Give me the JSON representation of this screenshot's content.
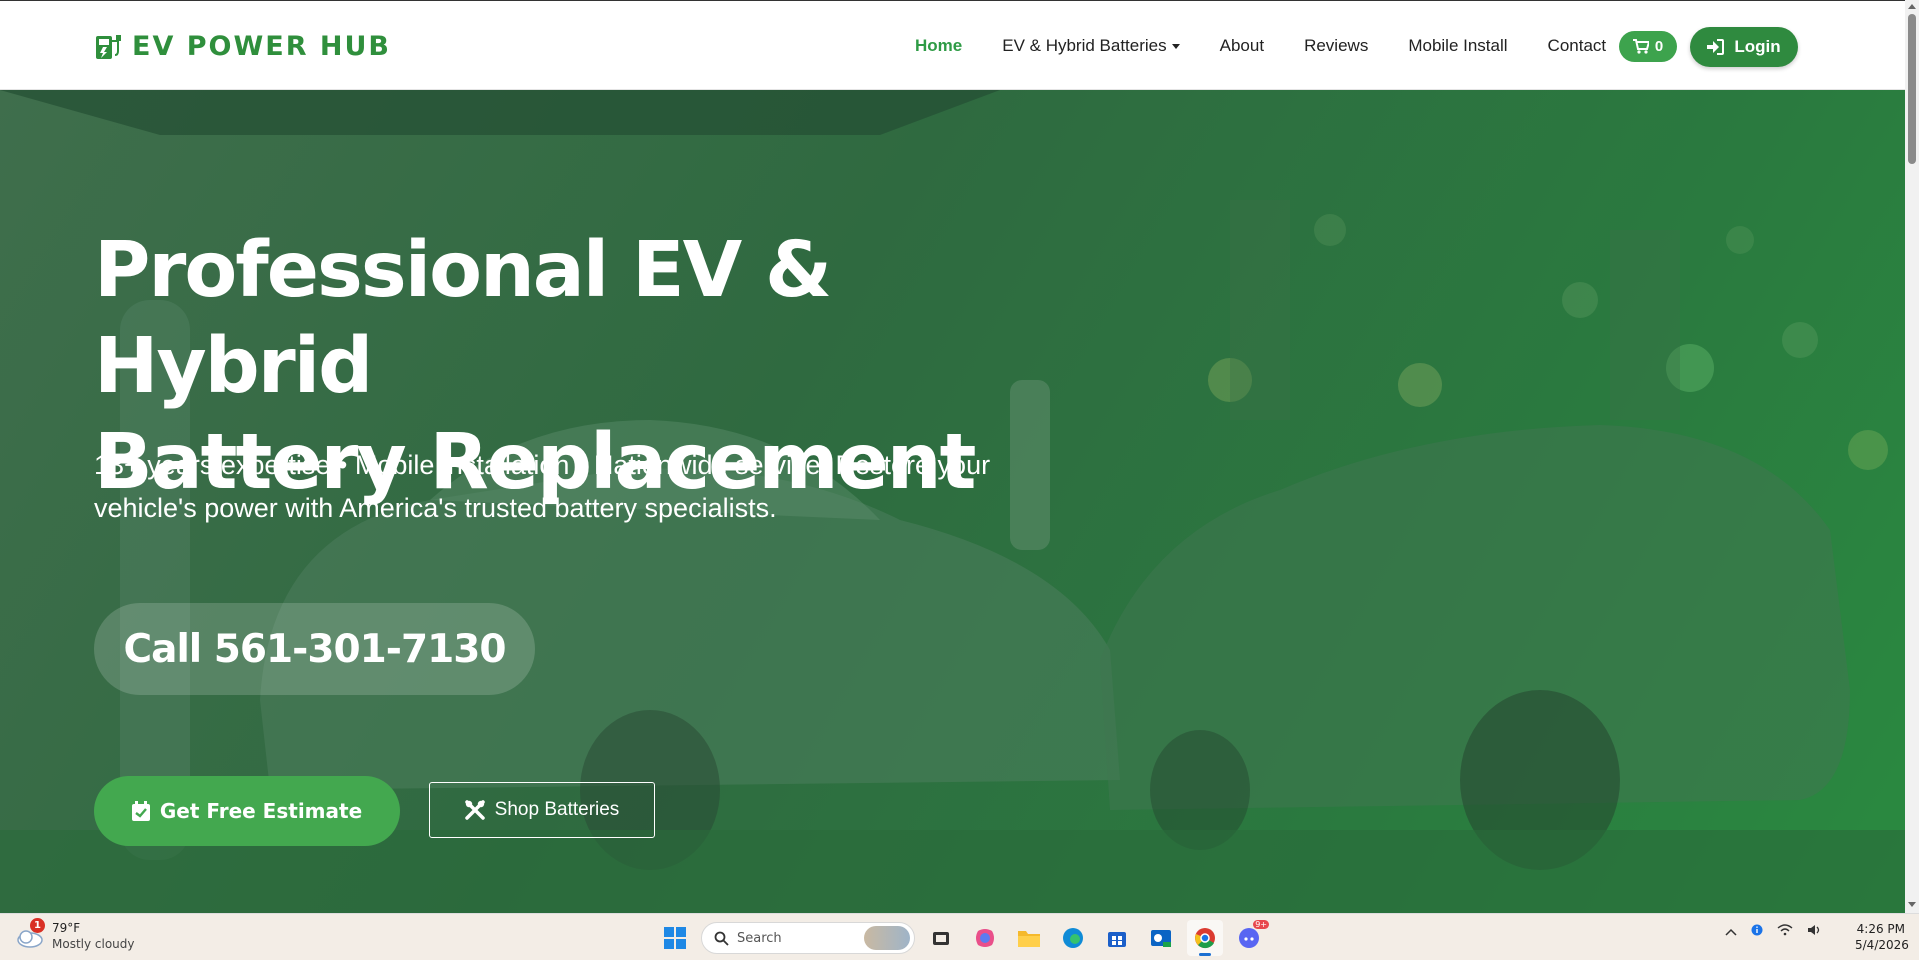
{
  "nav": {
    "brand": "EV POWER HUB",
    "links": [
      {
        "label": "Home"
      },
      {
        "label": "EV & Hybrid Batteries"
      },
      {
        "label": "About"
      },
      {
        "label": "Reviews"
      },
      {
        "label": "Mobile Install"
      },
      {
        "label": "Contact"
      }
    ],
    "cart_count": "0",
    "login_label": "Login"
  },
  "hero": {
    "title_line1": "Professional EV & Hybrid",
    "title_line2": "Battery Replacement",
    "subtitle_line1": "13+ years expertise • Mobile installation • Nationwide service. Restore your",
    "subtitle_line2": "vehicle's power with America's trusted battery specialists.",
    "call_label": "Call 561-301-7130",
    "estimate_label": "Get Free Estimate",
    "shop_label": "Shop Batteries"
  },
  "colors": {
    "brand_green": "#2f8f3c",
    "active_link": "#2e9b45",
    "button_green": "#43a84f",
    "hero_overlay": "#2f6a40"
  },
  "taskbar": {
    "weather_temp": "79°F",
    "weather_condition": "Mostly cloudy",
    "weather_badge": "1",
    "search_placeholder": "Search",
    "discord_badge": "9+",
    "time": "4:26 PM",
    "date": "5/4/2026"
  }
}
